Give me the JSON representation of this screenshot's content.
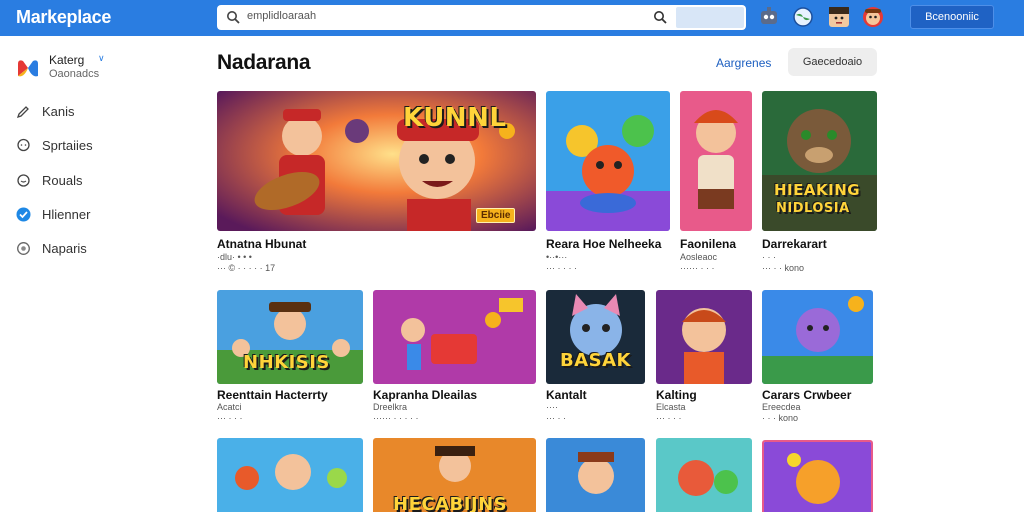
{
  "header": {
    "brand": "Markeplace",
    "search_placeholder": "emplidloaraah",
    "sign_in": "Bcenooniic"
  },
  "sidebar": {
    "profile_name": "Katerg",
    "profile_caret": "∨",
    "profile_sub": "Oaonadcs",
    "items": [
      {
        "label": "Kanis",
        "icon": "pencil-icon"
      },
      {
        "label": "Sprtaiies",
        "icon": "chat-icon"
      },
      {
        "label": "Rouals",
        "icon": "message-icon"
      },
      {
        "label": "Hlienner",
        "icon": "check-circle-icon"
      },
      {
        "label": "Naparis",
        "icon": "radio-icon"
      }
    ]
  },
  "main": {
    "title": "Nadarana",
    "link_label": "Aargrenes",
    "category_button": "Gaecedoaio"
  },
  "cards": [
    {
      "title": "Atnatna Hbunat",
      "meta1": "·dlu· • • •",
      "meta2": "··· © · · · · · 17",
      "overlay": "KUNNL",
      "badge": "Ebciie"
    },
    {
      "title": "Reara Hoe Nelheeka",
      "meta1": "•··•···",
      "meta2": "··· · · · ·"
    },
    {
      "title": "Faonilena",
      "meta1": "Aosleaoc",
      "meta2": "······ · · ·"
    },
    {
      "title": "Darrekarart",
      "meta1": "· · ·",
      "meta2": "··· · · kono",
      "overlay": "HIEAKING",
      "overlay2": "NIDLOSIA"
    },
    {
      "title": "Reenttain Hacterrty",
      "meta1": "Acatci",
      "meta2": "··· · · ·",
      "overlay": "NHKISIS"
    },
    {
      "title": "Kapranha Dleailas",
      "meta1": "Dreelkra",
      "meta2": "······ · · · · ·"
    },
    {
      "title": "Kantalt",
      "meta1": "····",
      "meta2": "··· · ·",
      "overlay": "BASAK"
    },
    {
      "title": "Kalting",
      "meta1": "Elcasta",
      "meta2": "··· · · ·"
    },
    {
      "title": "Carars Crwbeer",
      "meta1": "Ereecdea",
      "meta2": "· · · kono"
    },
    {
      "title": "",
      "meta1": "",
      "meta2": ""
    },
    {
      "title": "",
      "meta1": "",
      "meta2": "",
      "overlay": "HECABIJNS"
    },
    {
      "title": "",
      "meta1": "",
      "meta2": ""
    },
    {
      "title": "",
      "meta1": "",
      "meta2": ""
    },
    {
      "title": "",
      "meta1": "",
      "meta2": ""
    }
  ],
  "colors": {
    "topbar": "#2a7de1",
    "accent": "#1d5fc0",
    "badge": "#f6b21c"
  }
}
